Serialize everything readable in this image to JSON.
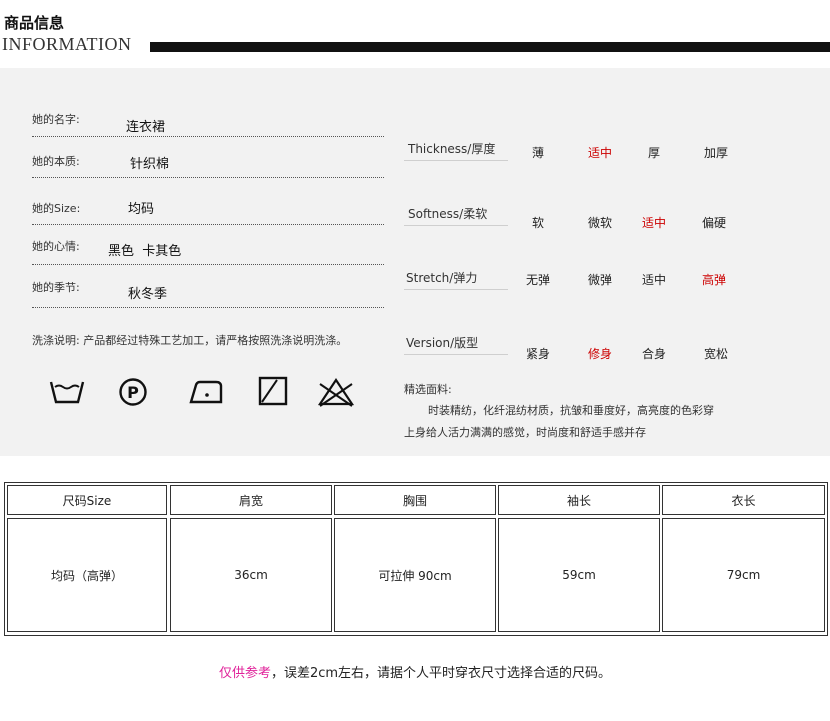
{
  "header": {
    "title_cn": "商品信息",
    "title_en": "INFORMATION"
  },
  "info": [
    {
      "label": "她的名字:",
      "value": "连衣裙"
    },
    {
      "label": "她的本质:",
      "value": "针织棉"
    },
    {
      "label": "她的Size:",
      "value": "均码"
    },
    {
      "label": "她的心情:",
      "value": "黑色  卡其色"
    },
    {
      "label": "她的季节:",
      "value": "秋冬季"
    }
  ],
  "care_note": "洗涤说明:   产品都经过特殊工艺加工，请严格按照洗涤说明洗涤。",
  "care_icons": [
    {
      "name": "hand-wash-icon"
    },
    {
      "name": "dry-clean-p-icon"
    },
    {
      "name": "iron-low-icon"
    },
    {
      "name": "line-dry-icon"
    },
    {
      "name": "do-not-bleach-icon"
    }
  ],
  "attributes": [
    {
      "label": "Thickness/厚度",
      "options": [
        "薄",
        "适中",
        "厚",
        "加厚"
      ],
      "selected": 1
    },
    {
      "label": "Softness/柔软",
      "options": [
        "软",
        "微软",
        "适中",
        "偏硬"
      ],
      "selected": 2
    },
    {
      "label": "Stretch/弹力",
      "options": [
        "无弹",
        "微弹",
        "适中",
        "高弹"
      ],
      "selected": 3
    },
    {
      "label": "Version/版型",
      "options": [
        "紧身",
        "修身",
        "合身",
        "宽松"
      ],
      "selected": 1
    }
  ],
  "fabric": {
    "title": "精选面料:",
    "line1": "时装精纺，化纤混纺材质，抗皱和垂度好，高亮度的色彩穿",
    "line2": "上身给人活力满满的感觉，时尚度和舒适手感并存"
  },
  "size_table": {
    "headers": [
      "尺码Size",
      "肩宽",
      "胸围",
      "袖长",
      "衣长"
    ],
    "row": [
      "均码（高弹）",
      "36cm",
      "可拉伸 90cm",
      "59cm",
      "79cm"
    ]
  },
  "footer": {
    "highlight": "仅供参考",
    "text": "，误差2cm左右，请据个人平时穿衣尺寸选择合适的尺码。"
  },
  "colors": {
    "selected": "#cc0000",
    "highlight": "#e0229a",
    "panel": "#f2f2f2"
  }
}
